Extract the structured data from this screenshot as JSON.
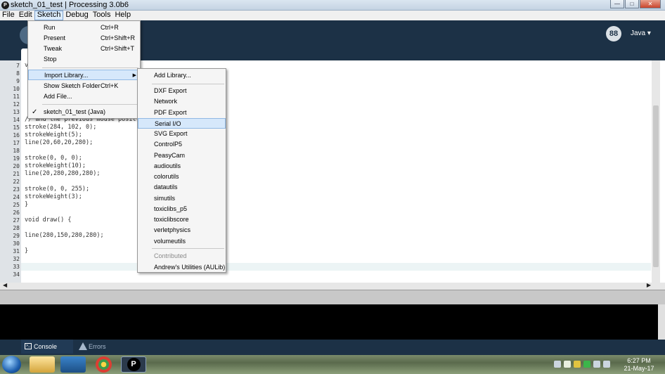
{
  "window": {
    "title": "sketch_01_test | Processing 3.0b6",
    "app_icon_letter": "P",
    "minimize": "—",
    "maximize": "□",
    "close": "✕"
  },
  "menubar": [
    "File",
    "Edit",
    "Sketch",
    "Debug",
    "Tools",
    "Help"
  ],
  "toolbar": {
    "mode": "Java ▾",
    "mode_icon": "88"
  },
  "editor": {
    "lines": [
      {
        "n": "7",
        "code": "v"
      },
      {
        "n": "8",
        "code": ""
      },
      {
        "n": "9",
        "code": ""
      },
      {
        "n": "10",
        "code": ""
      },
      {
        "n": "11",
        "code": ""
      },
      {
        "n": "12",
        "code": ""
      },
      {
        "n": "13",
        "code": ""
      },
      {
        "n": "14",
        "code": "// and the previous mouse posit"
      },
      {
        "n": "15",
        "code": "stroke(284, 102, 0);"
      },
      {
        "n": "16",
        "code": "strokeWeight(5);"
      },
      {
        "n": "17",
        "code": "line(20,60,20,280);"
      },
      {
        "n": "18",
        "code": ""
      },
      {
        "n": "19",
        "code": "stroke(0, 0, 0);"
      },
      {
        "n": "20",
        "code": "strokeWeight(10);"
      },
      {
        "n": "21",
        "code": "line(20,280,280,280);"
      },
      {
        "n": "22",
        "code": ""
      },
      {
        "n": "23",
        "code": "stroke(0, 0, 255);"
      },
      {
        "n": "24",
        "code": "strokeWeight(3);"
      },
      {
        "n": "25",
        "code": "}"
      },
      {
        "n": "26",
        "code": ""
      },
      {
        "n": "27",
        "code": "void draw() {"
      },
      {
        "n": "28",
        "code": ""
      },
      {
        "n": "29",
        "code": "line(280,150,280,280);"
      },
      {
        "n": "30",
        "code": ""
      },
      {
        "n": "31",
        "code": "}"
      },
      {
        "n": "32",
        "code": ""
      },
      {
        "n": "33",
        "code": ""
      },
      {
        "n": "34",
        "code": ""
      }
    ]
  },
  "sketch_menu": {
    "run": {
      "label": "Run",
      "shortcut": "Ctrl+R"
    },
    "present": {
      "label": "Present",
      "shortcut": "Ctrl+Shift+R"
    },
    "tweak": {
      "label": "Tweak",
      "shortcut": "Ctrl+Shift+T"
    },
    "stop": {
      "label": "Stop"
    },
    "import_library": {
      "label": "Import Library...",
      "arrow": "▶"
    },
    "show_folder": {
      "label": "Show Sketch Folder",
      "shortcut": "Ctrl+K"
    },
    "add_file": {
      "label": "Add File..."
    },
    "current_sketch": {
      "label": "sketch_01_test (Java)",
      "check": "✓"
    }
  },
  "import_library": {
    "add": "Add Library...",
    "libs": [
      "DXF Export",
      "Network",
      "PDF Export",
      "Serial I/O",
      "SVG Export",
      "ControlP5",
      "PeasyCam",
      "audioutils",
      "colorutils",
      "datautils",
      "simutils",
      "toxiclibs_p5",
      "toxiclibscore",
      "verletphysics",
      "volumeutils"
    ],
    "contributed_header": "Contributed",
    "contributed": [
      "Andrew's Utilities (AULib)"
    ]
  },
  "footer": {
    "console": "Console",
    "errors": "Errors"
  },
  "taskbar": {
    "time": "6:27 PM",
    "date": "21-May-17",
    "processing_icon": "P"
  },
  "scroll": {
    "left": "◀",
    "right": "▶"
  }
}
